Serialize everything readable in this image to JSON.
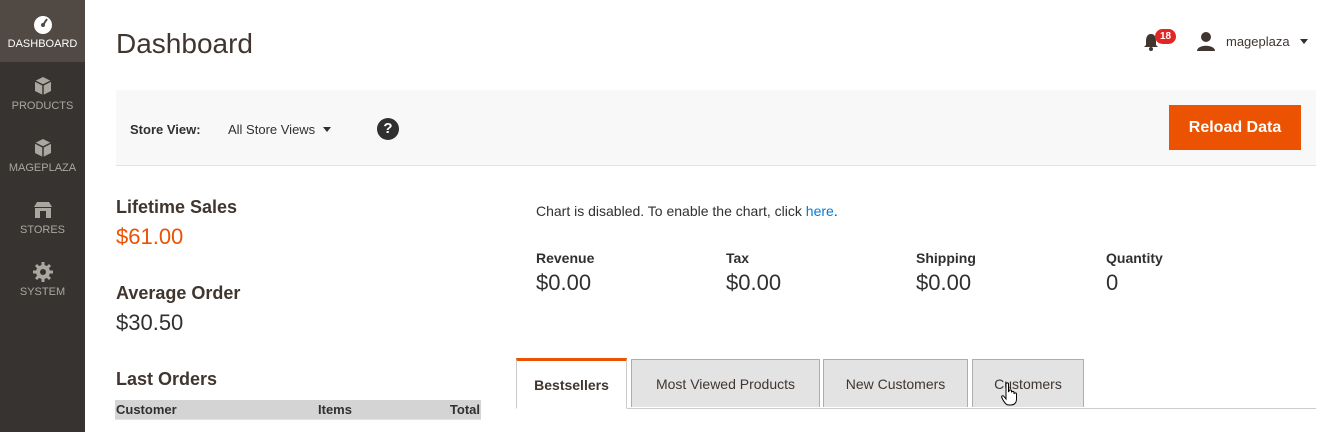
{
  "sidebar": {
    "items": [
      {
        "label": "DASHBOARD",
        "icon": "dashboard-icon",
        "active": true
      },
      {
        "label": "PRODUCTS",
        "icon": "box-icon",
        "active": false
      },
      {
        "label": "MAGEPLAZA",
        "icon": "box-icon",
        "active": false
      },
      {
        "label": "STORES",
        "icon": "store-icon",
        "active": false
      },
      {
        "label": "SYSTEM",
        "icon": "gear-icon",
        "active": false
      }
    ]
  },
  "header": {
    "title": "Dashboard",
    "notifications_count": "18",
    "user_name": "mageplaza"
  },
  "store_bar": {
    "label": "Store View:",
    "selected": "All Store Views",
    "help": "?",
    "reload_label": "Reload Data"
  },
  "stats": {
    "lifetime_sales_label": "Lifetime Sales",
    "lifetime_sales_value": "$61.00",
    "average_order_label": "Average Order",
    "average_order_value": "$30.50",
    "last_orders_label": "Last Orders",
    "orders_columns": [
      "Customer",
      "Items",
      "Total"
    ]
  },
  "chart_note": {
    "text": "Chart is disabled. To enable the chart, click ",
    "link": "here",
    "suffix": "."
  },
  "totals": [
    {
      "label": "Revenue",
      "value": "$0.00"
    },
    {
      "label": "Tax",
      "value": "$0.00"
    },
    {
      "label": "Shipping",
      "value": "$0.00"
    },
    {
      "label": "Quantity",
      "value": "0"
    }
  ],
  "tabs": [
    {
      "label": "Bestsellers",
      "active": true
    },
    {
      "label": "Most Viewed Products",
      "active": false
    },
    {
      "label": "New Customers",
      "active": false
    },
    {
      "label": "Customers",
      "active": false
    }
  ],
  "colors": {
    "accent": "#eb5202",
    "sidebar": "#373330",
    "link": "#007bdb"
  }
}
